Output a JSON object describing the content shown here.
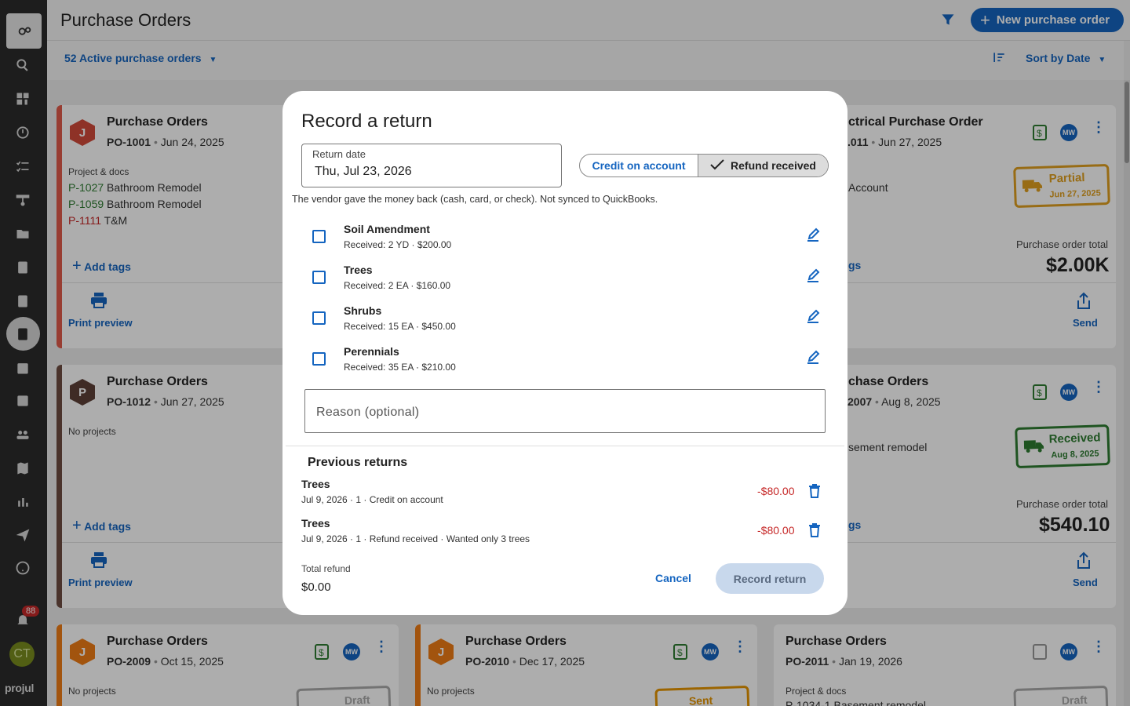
{
  "app": {
    "logo": "projul",
    "notification_count": "88",
    "avatar_initials": "CT"
  },
  "header": {
    "title": "Purchase Orders",
    "new_button": "New purchase order"
  },
  "subbar": {
    "active_filter": "52 Active purchase orders",
    "sort_label": "Sort by Date"
  },
  "cards": {
    "c1": {
      "title": "Purchase Orders",
      "po": "PO-1001",
      "date": "Jun 24, 2025",
      "avatar": "J",
      "projects_label": "Project & docs",
      "projects": [
        {
          "code": "P-1027",
          "name": "Bathroom Remodel"
        },
        {
          "code": "P-1059",
          "name": "Bathroom Remodel"
        },
        {
          "code": "P-1111",
          "name": "T&M"
        }
      ],
      "add_tags": "Add tags",
      "print": "Print preview"
    },
    "c2": {
      "title": "ctrical Purchase Order",
      "po": ".011",
      "date": "Jun 27, 2025",
      "project": "Account",
      "stamp_title": "Partial",
      "stamp_date": "Jun 27, 2025",
      "tags": "gs",
      "total_label": "Purchase order total",
      "total": "$2.00K",
      "send": "Send",
      "mw": "MW"
    },
    "c3": {
      "title": "Purchase Orders",
      "po": "PO-1012",
      "date": "Jun 27, 2025",
      "avatar": "P",
      "no_projects": "No projects",
      "add_tags": "Add tags",
      "print": "Print preview"
    },
    "c4": {
      "title": "chase Orders",
      "po": "2007",
      "date": "Aug 8, 2025",
      "project": "sement remodel",
      "stamp_title": "Received",
      "stamp_date": "Aug 8, 2025",
      "tags": "gs",
      "total_label": "Purchase order total",
      "total": "$540.10",
      "send": "Send",
      "mw": "MW"
    },
    "c5": {
      "title": "Purchase Orders",
      "po": "PO-2009",
      "date": "Oct 15, 2025",
      "avatar": "J",
      "no_projects": "No projects",
      "stamp": "Draft",
      "mw": "MW"
    },
    "c6": {
      "title": "Purchase Orders",
      "po": "PO-2010",
      "date": "Dec 17, 2025",
      "avatar": "J",
      "no_projects": "No projects",
      "stamp": "Sent",
      "mw": "MW"
    },
    "c7": {
      "title": "Purchase Orders",
      "po": "PO-2011",
      "date": "Jan 19, 2026",
      "projects_label": "Project & docs",
      "project_partial": "P-1034-1 Basement remodel",
      "stamp": "Draft",
      "mw": "MW"
    }
  },
  "modal": {
    "title": "Record a return",
    "date_label": "Return date",
    "date_value": "Thu, Jul 23, 2026",
    "mode_credit": "Credit on account",
    "mode_refund": "Refund received",
    "helper": "The vendor gave the money back (cash, card, or check). Not synced to QuickBooks.",
    "items": [
      {
        "name": "Soil Amendment",
        "detail": "Received: 2 YD · $200.00"
      },
      {
        "name": "Trees",
        "detail": "Received: 2 EA · $160.00"
      },
      {
        "name": "Shrubs",
        "detail": "Received: 15 EA · $450.00"
      },
      {
        "name": "Perennials",
        "detail": "Received: 35 EA · $210.00"
      }
    ],
    "reason_placeholder": "Reason (optional)",
    "previous_title": "Previous returns",
    "previous": [
      {
        "name": "Trees",
        "detail": "Jul 9, 2026 · 1 · Credit on account",
        "amount": "-$80.00"
      },
      {
        "name": "Trees",
        "detail": "Jul 9, 2026 · 1 · Refund received · Wanted only 3 trees",
        "amount": "-$80.00"
      }
    ],
    "total_label": "Total refund",
    "total_value": "$0.00",
    "cancel": "Cancel",
    "record": "Record return"
  },
  "colors": {
    "accent": "#1565c0",
    "negative": "#c62828",
    "partial": "#e0a020",
    "received": "#2e7d32",
    "sent": "#e69500"
  }
}
